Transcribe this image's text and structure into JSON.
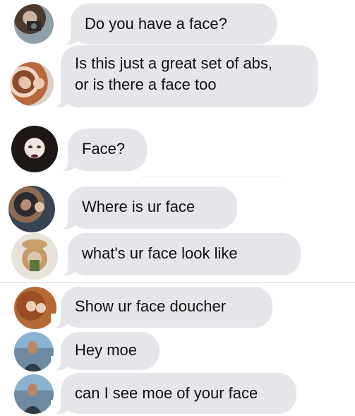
{
  "messages": [
    {
      "text": "Do you have a face?",
      "avatar": "avatar-photo-icon"
    },
    {
      "text": "Is this just a great set of abs,\nor is there a face too",
      "avatar": "avatar-photo-icon"
    },
    {
      "text": "Face?",
      "avatar": "avatar-photo-icon"
    },
    {
      "text": "Where is ur face",
      "avatar": "avatar-photo-icon"
    },
    {
      "text": "what's ur face look like",
      "avatar": "avatar-photo-icon"
    },
    {
      "text": "Show ur face doucher",
      "avatar": "avatar-photo-icon"
    },
    {
      "text": "Hey moe",
      "avatar": "avatar-photo-icon"
    },
    {
      "text": "can I see moe of your face",
      "avatar": "avatar-photo-icon"
    }
  ],
  "colors": {
    "bubble": "#e5e5ea",
    "text": "#111111",
    "background": "#ffffff"
  }
}
